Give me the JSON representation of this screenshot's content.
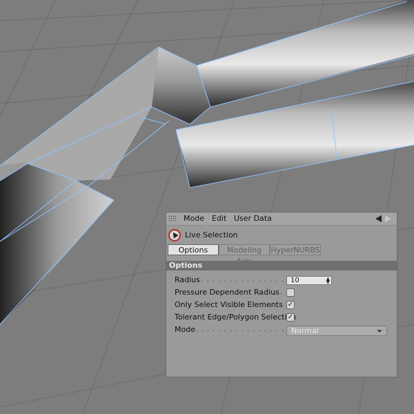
{
  "menubar": {
    "items": [
      "Mode",
      "Edit",
      "User Data"
    ]
  },
  "tool": {
    "name": "Live Selection",
    "icon": "live-selection-icon"
  },
  "tabs": [
    {
      "label": "Options",
      "active": true
    },
    {
      "label": "Modeling Axis",
      "active": false
    },
    {
      "label": "HyperNURBS",
      "active": false
    }
  ],
  "section": {
    "title": "Options"
  },
  "props": {
    "radius": {
      "label": "Radius",
      "value": "10"
    },
    "pressure": {
      "label": "Pressure Dependent Radius",
      "checked": false
    },
    "visible_only": {
      "label": "Only Select Visible Elements",
      "checked": true
    },
    "tolerant": {
      "label": "Tolerant Edge/Polygon Selection",
      "checked": true
    },
    "mode": {
      "label": "Mode",
      "value": "Normal"
    }
  },
  "colors": {
    "edge": "#8fc3ff",
    "panel": "#9a9a9a",
    "section": "#6f6f6f"
  }
}
